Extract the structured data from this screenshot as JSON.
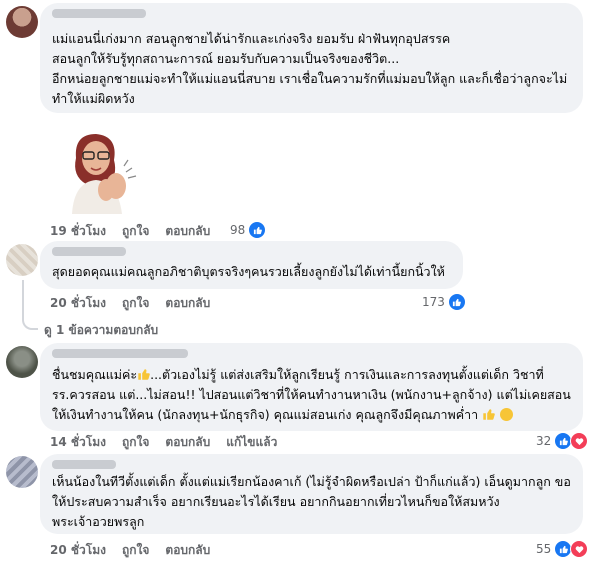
{
  "comments": [
    {
      "lines": [
        "แม่แอนนี่เก่งมาก สอนลูกชายได้น่ารักและเก่งจริง ยอมรับ ฝ่าฟันทุกอุปสรรค",
        "สอนลูกให้รับรู้ทุกสถานะการณ์ ยอมรับกับความเป็นจริงของชีวิต...",
        "อีกหน่อยลูกชายแม่จะทำให้แม่แอนนี่สบาย เราเชื่อในความรักที่แม่มอบให้ลูก และก็เชื่อว่าลูกจะไม่",
        "ทำให้แม่ผิดหวัง"
      ],
      "time": "19 ชั่วโมง",
      "like": "ถูกใจ",
      "reply": "ตอบกลับ",
      "reaction_count": "98"
    },
    {
      "lines": [
        "สุดยอดคุณแม่คณลูกอภิชาติบุตรจริงๆคนรวยเลี้ยงลูกยังไม่ได้เท่านี้ยกนิ้วให้"
      ],
      "time": "20 ชั่วโมง",
      "like": "ถูกใจ",
      "reply": "ตอบกลับ",
      "reaction_count": "173",
      "replies_link": "ดู 1 ข้อความตอบกลับ"
    },
    {
      "lines": [
        "ชื่นชมคุณแม่ค่ะ",
        "...ตัวเองไม่รู้ แต่ส่งเสริมให้ลูกเรียนรู้ การเงินและการลงทุนตั้งแต่เด็ก วิชาที่",
        "รร.ควรสอน แต่...ไม่สอน!! ไปสอนแต่วิชาที่ให้คนทำงานหาเงิน (พนักงาน+ลูกจ้าง) แต่ไม่เคยสอน",
        "ให้เงินทำงานให้คน (นักลงทุน+นักธุรกิจ) คุณแม่สอนเก่ง คุณลูกจึงมีคุณภาพค่ำา"
      ],
      "time": "14 ชั่วโมง",
      "like": "ถูกใจ",
      "reply": "ตอบกลับ",
      "edited": "แก้ไขแล้ว",
      "reaction_count": "32"
    },
    {
      "lines": [
        "เห็นน้องในทีวีตั้งแต่เด็ก ตั้งแต่แม่เรียกน้องคาเก้ (ไม่รู้จำผิดหรือเปล่า ป้าก็แก่แล้ว) เอ็นดูมากลูก ขอ",
        "ให้ประสบความสำเร็จ อยากเรียนอะไรได้เรียน อยากกินอยากเที่ยวไหนก็ขอให้สมหวัง",
        "พระเจ้าอวยพรลูก"
      ],
      "time": "20 ชั่วโมง",
      "like": "ถูกใจ",
      "reply": "ตอบกลับ",
      "reaction_count": "55"
    }
  ],
  "colors": {
    "bubble": "#f0f2f5",
    "meta": "#65676b",
    "like_blue": "#1877f2",
    "love_red": "#f33e58"
  },
  "icons": [
    "like-icon",
    "love-icon",
    "avatar",
    "sticker-clapping-woman",
    "thumbs-up-emoji",
    "smile-emoji"
  ]
}
